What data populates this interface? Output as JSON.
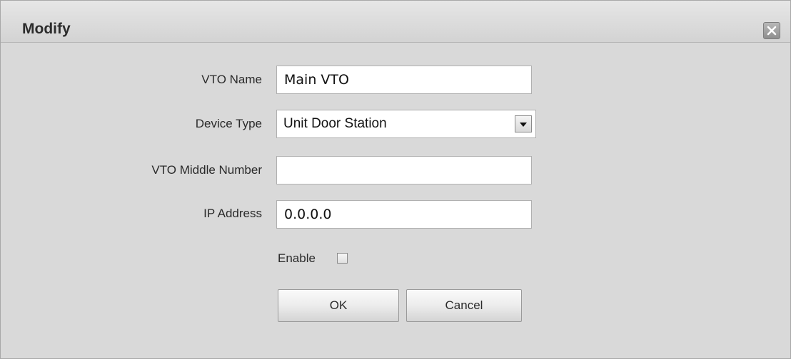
{
  "dialog": {
    "title": "Modify",
    "close_icon": "close-icon"
  },
  "form": {
    "vto_name": {
      "label": "VTO Name",
      "value": "Main VTO"
    },
    "device_type": {
      "label": "Device Type",
      "selected": "Unit Door Station",
      "arrow_icon": "chevron-down-icon"
    },
    "vto_middle_number": {
      "label": "VTO Middle Number",
      "value": ""
    },
    "ip_address": {
      "label": "IP Address",
      "value": "0.0.0.0"
    },
    "enable": {
      "label": "Enable",
      "checked": false
    }
  },
  "buttons": {
    "ok_label": "OK",
    "cancel_label": "Cancel"
  },
  "colors": {
    "dialog_background": "#d9d9d9",
    "titlebar": "#dcdcdc",
    "close_button": "#9e9e9e"
  }
}
